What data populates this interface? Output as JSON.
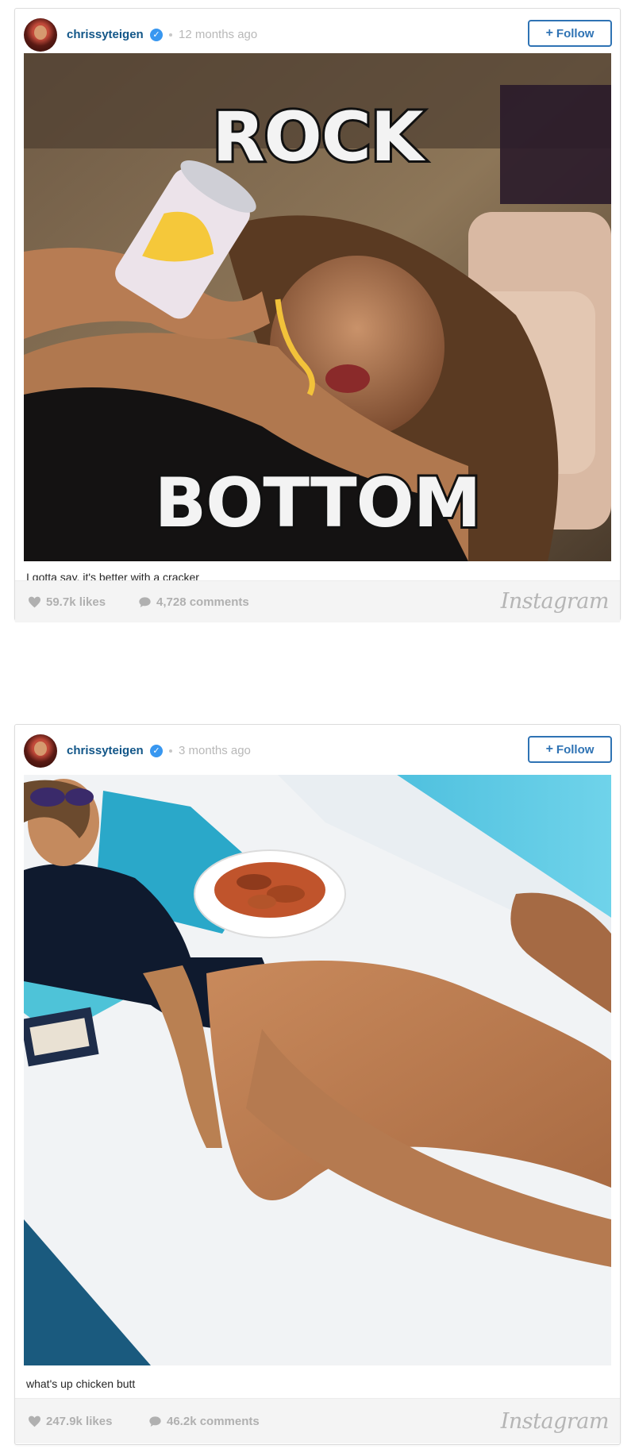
{
  "posts": [
    {
      "username": "chrissyteigen",
      "verified": true,
      "time_ago": "12 months ago",
      "follow_label": "Follow",
      "meme_top": "ROCK",
      "meme_bottom": "BOTTOM",
      "caption": "I gotta say, it's better with a cracker",
      "likes": "59.7k likes",
      "comments": "4,728 comments",
      "brand": "Instagram"
    },
    {
      "username": "chrissyteigen",
      "verified": true,
      "time_ago": "3 months ago",
      "follow_label": "Follow",
      "caption": "what's up chicken butt",
      "likes": "247.9k likes",
      "comments": "46.2k comments",
      "brand": "Instagram"
    }
  ],
  "colors": {
    "username": "#125688",
    "follow_border": "#2f73b4",
    "verified_badge": "#3897f0",
    "muted": "#b0b0b0"
  },
  "icons": {
    "verified": "check-badge-icon",
    "likes": "heart-icon",
    "comments": "comment-bubble-icon",
    "follow_plus": "plus-icon"
  }
}
